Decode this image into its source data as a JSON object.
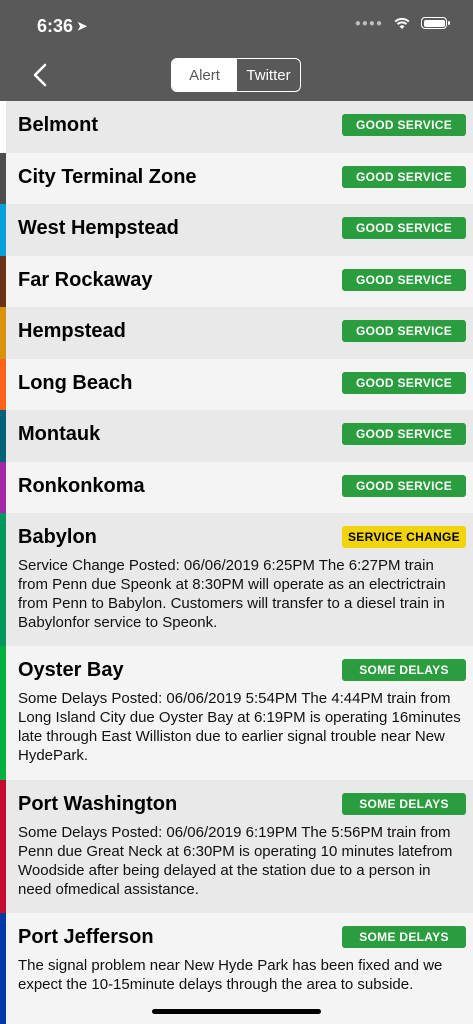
{
  "status": {
    "time": "6:36"
  },
  "segment": {
    "alert": "Alert",
    "twitter": "Twitter"
  },
  "branches": [
    {
      "name": "Belmont",
      "status": "GOOD SERVICE",
      "kind": "good",
      "color": "#ffffff"
    },
    {
      "name": "City Terminal Zone",
      "status": "GOOD SERVICE",
      "kind": "good",
      "color": "#4d4d4d"
    },
    {
      "name": "West Hempstead",
      "status": "GOOD SERVICE",
      "kind": "good",
      "color": "#0aa0dc"
    },
    {
      "name": "Far Rockaway",
      "status": "GOOD SERVICE",
      "kind": "good",
      "color": "#6e3219"
    },
    {
      "name": "Hempstead",
      "status": "GOOD SERVICE",
      "kind": "good",
      "color": "#d9930d"
    },
    {
      "name": "Long Beach",
      "status": "GOOD SERVICE",
      "kind": "good",
      "color": "#ff6319"
    },
    {
      "name": "Montauk",
      "status": "GOOD SERVICE",
      "kind": "good",
      "color": "#00637a"
    },
    {
      "name": "Ronkonkoma",
      "status": "GOOD SERVICE",
      "kind": "good",
      "color": "#a626aa"
    },
    {
      "name": "Babylon",
      "status": "SERVICE CHANGE",
      "kind": "change",
      "color": "#00985f",
      "desc": "Service Change Posted: 06/06/2019 6:25PM The 6:27PM train from Penn due Speonk at 8:30PM will operate as an electrictrain from Penn to Babylon. Customers will transfer to a diesel train in Babylonfor service to Speonk."
    },
    {
      "name": "Oyster Bay",
      "status": "SOME DELAYS",
      "kind": "delay",
      "color": "#00b140",
      "desc": "Some Delays Posted: 06/06/2019 5:54PM The 4:44PM train from Long Island City due Oyster Bay at 6:19PM is operating 16minutes late through East Williston due to earlier signal trouble near New HydePark."
    },
    {
      "name": "Port Washington",
      "status": "SOME DELAYS",
      "kind": "delay",
      "color": "#c60c30",
      "desc": "Some Delays Posted: 06/06/2019 6:19PM The 5:56PM train from Penn due Great Neck at 6:30PM is operating 10 minutes latefrom Woodside after being delayed at the station due to a person in need ofmedical assistance."
    },
    {
      "name": "Port Jefferson",
      "status": "SOME DELAYS",
      "kind": "delay",
      "color": "#0039a6",
      "desc": "The signal problem near New Hyde Park has been fixed and we expect the 10-15minute delays through the area to subside."
    }
  ]
}
